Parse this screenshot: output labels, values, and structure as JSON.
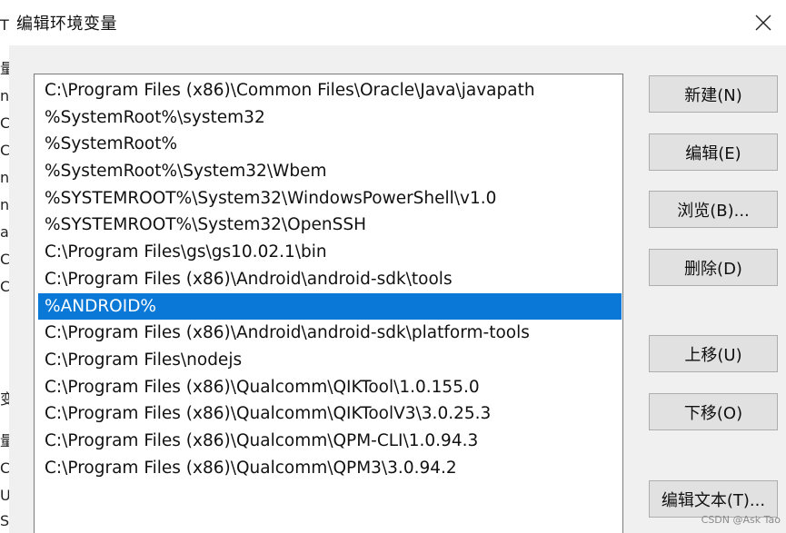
{
  "dialog": {
    "title": "编辑环境变量",
    "close_glyph": "×"
  },
  "path_list": {
    "items": [
      "C:\\Program Files (x86)\\Common Files\\Oracle\\Java\\javapath",
      "%SystemRoot%\\system32",
      "%SystemRoot%",
      "%SystemRoot%\\System32\\Wbem",
      "%SYSTEMROOT%\\System32\\WindowsPowerShell\\v1.0",
      "%SYSTEMROOT%\\System32\\OpenSSH",
      "C:\\Program Files\\gs\\gs10.02.1\\bin",
      "C:\\Program Files (x86)\\Android\\android-sdk\\tools",
      "%ANDROID%",
      "C:\\Program Files (x86)\\Android\\android-sdk\\platform-tools",
      "C:\\Program Files\\nodejs",
      "C:\\Program Files (x86)\\Qualcomm\\QIKTool\\1.0.155.0",
      "C:\\Program Files (x86)\\Qualcomm\\QIKToolV3\\3.0.25.3",
      "C:\\Program Files (x86)\\Qualcomm\\QPM-CLI\\1.0.94.3",
      "C:\\Program Files (x86)\\Qualcomm\\QPM3\\3.0.94.2",
      "",
      ""
    ],
    "selected_index": 8
  },
  "buttons": {
    "new_label": "新建(N)",
    "edit_label": "编辑(E)",
    "browse_label": "浏览(B)...",
    "delete_label": "删除(D)",
    "move_up_label": "上移(U)",
    "move_down_label": "下移(O)",
    "edit_text_label": "编辑文本(T)..."
  },
  "background_window": {
    "fragments": [
      "T",
      "量",
      "n",
      "C",
      "C",
      "n",
      "n",
      "a",
      "C",
      "C",
      "变",
      "量",
      "C",
      "U",
      "S"
    ]
  },
  "watermark": "CSDN @Ask Tao",
  "colors": {
    "selection": "#0a78d7",
    "dialog_bg": "#f0f0f0",
    "button_bg": "#e1e1e1"
  }
}
